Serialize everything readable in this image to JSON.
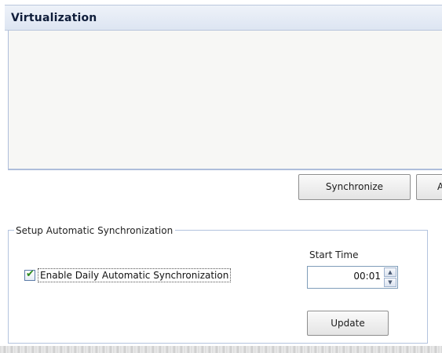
{
  "panel": {
    "title": "Virtualization"
  },
  "toolbar": {
    "synchronize_label": "Synchronize",
    "cutoff_button_label": "A"
  },
  "auto_sync": {
    "group_label": "Setup Automatic Synchronization",
    "enable_label": "Enable Daily Automatic Synchronization",
    "enable_checked": true,
    "start_time_label": "Start Time",
    "start_time_value": "00:01",
    "update_label": "Update"
  },
  "icons": {
    "checkbox": "check-icon",
    "spinner_up": "up-arrow-icon",
    "spinner_down": "down-arrow-icon"
  },
  "colors": {
    "header_bg": "#dde5f2",
    "border_accent": "#aebedb",
    "check_green": "#2b8a1e"
  }
}
